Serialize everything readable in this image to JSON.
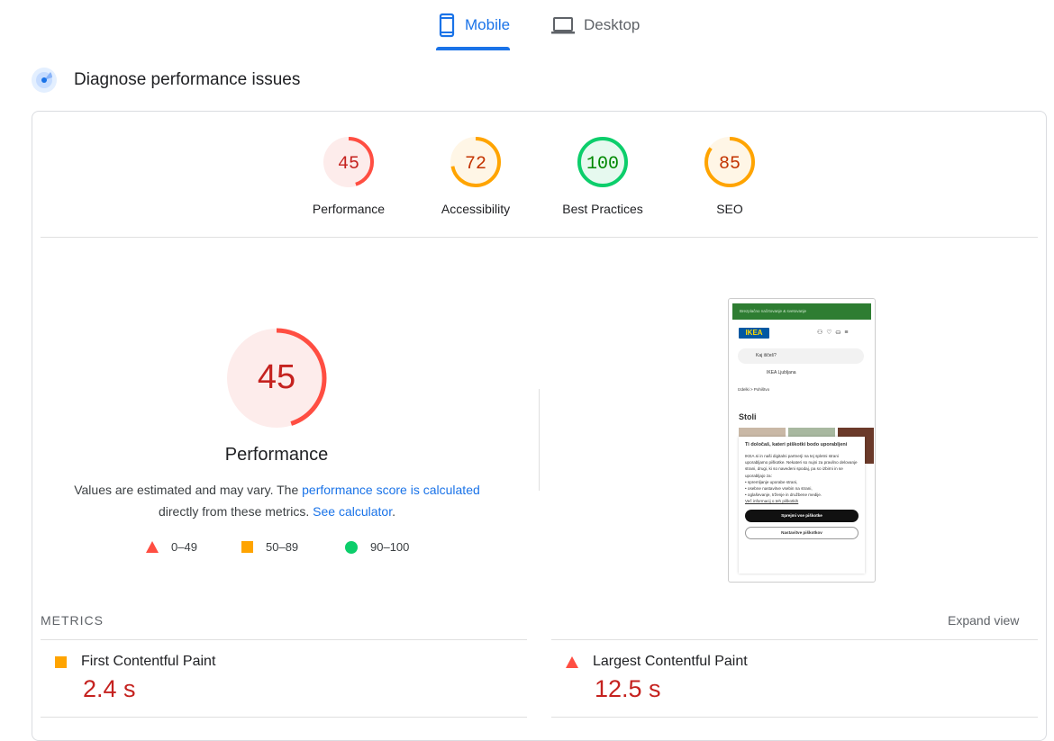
{
  "tabs": [
    {
      "label": "Mobile",
      "icon": "smartphone-icon",
      "active": true
    },
    {
      "label": "Desktop",
      "icon": "laptop-icon",
      "active": false
    }
  ],
  "section_title": "Diagnose performance issues",
  "colors": {
    "fail": "#ff4e42",
    "average": "#ffa400",
    "pass": "#0cce6b",
    "fail_text": "#c5221f",
    "average_text": "#c33300",
    "pass_text": "#008800",
    "accent": "#1a73e8"
  },
  "categories": [
    {
      "label": "Performance",
      "score": 45,
      "rating": "fail"
    },
    {
      "label": "Accessibility",
      "score": 72,
      "rating": "average"
    },
    {
      "label": "Best Practices",
      "score": 100,
      "rating": "pass"
    },
    {
      "label": "SEO",
      "score": 85,
      "rating": "average"
    }
  ],
  "main_gauge": {
    "score": 45,
    "label": "Performance"
  },
  "description": {
    "prefix": "Values are estimated and may vary. The ",
    "link1": "performance score is calculated",
    "middle": " directly from these metrics. ",
    "link2": "See calculator",
    "suffix": "."
  },
  "legend": [
    {
      "range": "0–49",
      "shape": "triangle"
    },
    {
      "range": "50–89",
      "shape": "square"
    },
    {
      "range": "90–100",
      "shape": "circle"
    }
  ],
  "screenshot": {
    "banner": "Brezplačno načrtovanje & svetovanje",
    "logo": "IKEA",
    "search_placeholder": "Kaj iščeš?",
    "store": "IKEA Ljubljana",
    "breadcrumb": "Izdelki  >  Pohištvo",
    "heading": "Stoli",
    "cookie_title": "Ti določaš, kateri piškotki bodo uporabljeni",
    "cookie_text": "IKEA.si in naši digitalni partnerji na tej spletni strani uporabljamo piškotke. Nekateri so nujni za pravilno delovanje strani, drugi, ki so navedeni spodaj, pa so izbirni in se uporabljajo za:",
    "cookie_items": [
      "spremljanje uporabe strani,",
      "osebne nastavitve vsebin na strani,",
      "oglaševanje, trženje in družbene medije."
    ],
    "cookie_link": "Več informacij o teh piškotkih",
    "accept": "Sprejmi vse piškotke",
    "settings": "Nastavitve piškotkov"
  },
  "metrics_header": "METRICS",
  "expand_view": "Expand view",
  "metrics": [
    {
      "name": "First Contentful Paint",
      "value": "2.4 s",
      "rating": "average"
    },
    {
      "name": "Largest Contentful Paint",
      "value": "12.5 s",
      "rating": "fail"
    }
  ]
}
